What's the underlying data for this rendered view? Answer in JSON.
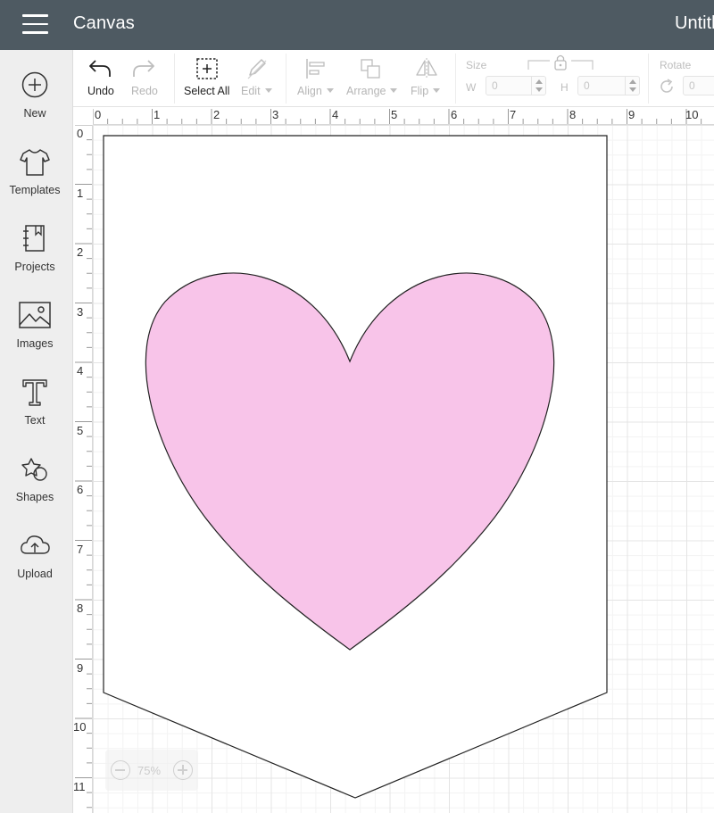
{
  "header": {
    "app_title": "Canvas",
    "project_title": "Untitled"
  },
  "sidebar": {
    "items": [
      {
        "label": "New",
        "icon": "plus-circle-icon"
      },
      {
        "label": "Templates",
        "icon": "tshirt-icon"
      },
      {
        "label": "Projects",
        "icon": "notebook-icon"
      },
      {
        "label": "Images",
        "icon": "picture-icon"
      },
      {
        "label": "Text",
        "icon": "text-T-icon"
      },
      {
        "label": "Shapes",
        "icon": "shapes-icon"
      },
      {
        "label": "Upload",
        "icon": "cloud-upload-icon"
      }
    ]
  },
  "toolbar": {
    "undo": "Undo",
    "redo": "Redo",
    "select_all": "Select All",
    "edit": "Edit",
    "align": "Align",
    "arrange": "Arrange",
    "flip": "Flip",
    "size": "Size",
    "w": "W",
    "h": "H",
    "w_value": "0",
    "h_value": "0",
    "rotate": "Rotate",
    "rotate_value": "0"
  },
  "rulers": {
    "top": [
      "0",
      "1",
      "2",
      "3",
      "4",
      "5",
      "6",
      "7",
      "8",
      "9",
      "10"
    ],
    "left": [
      "0",
      "1",
      "2",
      "3",
      "4",
      "5",
      "6",
      "7",
      "8",
      "9",
      "10",
      "11"
    ]
  },
  "canvas": {
    "heart_fill": "#f8c4e9",
    "outline": "#222222"
  },
  "zoom": {
    "value": "75%"
  }
}
